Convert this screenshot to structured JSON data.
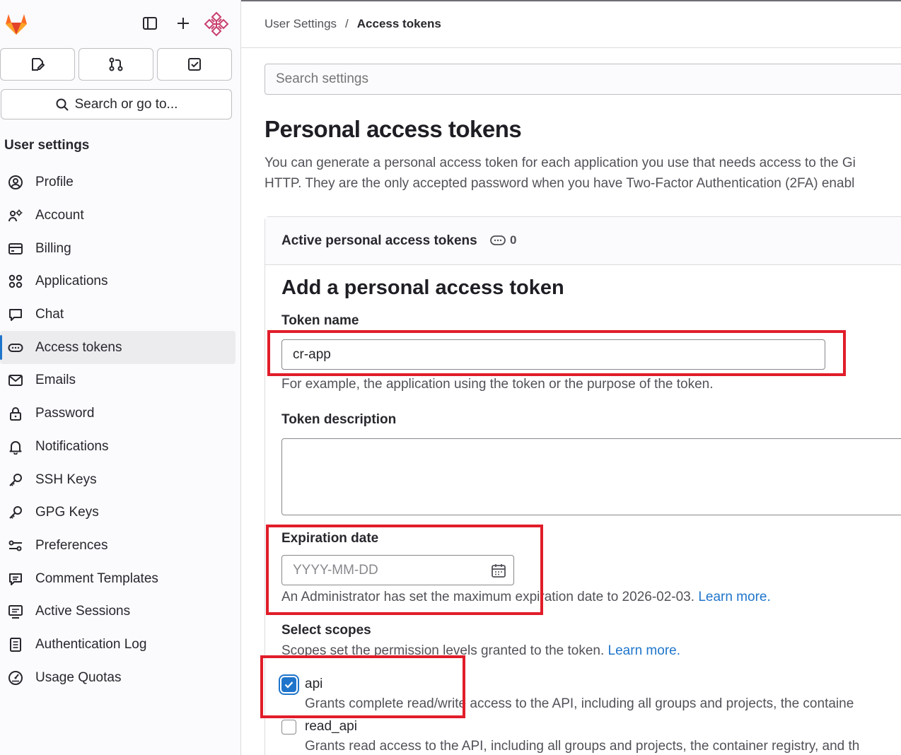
{
  "colors": {
    "accent": "#1f75cb",
    "highlight": "#e11d2a",
    "logo_orange": "#e24329"
  },
  "topbar": {
    "sidebar_toggle_icon": "sidebar-icon",
    "new_icon": "plus-icon",
    "avatar_icon": "avatar-identicon"
  },
  "shortcuts": [
    "issues-icon",
    "merge-request-icon",
    "todo-icon"
  ],
  "search": {
    "label": "Search or go to..."
  },
  "sidebar": {
    "heading": "User settings",
    "items": [
      {
        "label": "Profile",
        "icon": "profile-icon"
      },
      {
        "label": "Account",
        "icon": "account-icon"
      },
      {
        "label": "Billing",
        "icon": "billing-icon"
      },
      {
        "label": "Applications",
        "icon": "applications-icon"
      },
      {
        "label": "Chat",
        "icon": "chat-icon"
      },
      {
        "label": "Access tokens",
        "icon": "token-icon",
        "active": true
      },
      {
        "label": "Emails",
        "icon": "mail-icon"
      },
      {
        "label": "Password",
        "icon": "lock-icon"
      },
      {
        "label": "Notifications",
        "icon": "bell-icon"
      },
      {
        "label": "SSH Keys",
        "icon": "key-icon"
      },
      {
        "label": "GPG Keys",
        "icon": "key-icon"
      },
      {
        "label": "Preferences",
        "icon": "preferences-icon"
      },
      {
        "label": "Comment Templates",
        "icon": "comment-icon"
      },
      {
        "label": "Active Sessions",
        "icon": "monitor-icon"
      },
      {
        "label": "Authentication Log",
        "icon": "log-icon"
      },
      {
        "label": "Usage Quotas",
        "icon": "quota-icon"
      }
    ]
  },
  "breadcrumb": {
    "parent": "User Settings",
    "separator": "/",
    "current": "Access tokens"
  },
  "settings_search": {
    "placeholder": "Search settings"
  },
  "page": {
    "title": "Personal access tokens",
    "desc_line1": "You can generate a personal access token for each application you use that needs access to the Gi",
    "desc_line2": "HTTP. They are the only accepted password when you have Two-Factor Authentication (2FA) enabl"
  },
  "active_tokens": {
    "title": "Active personal access tokens",
    "count": "0",
    "icon": "token-icon"
  },
  "form": {
    "title": "Add a personal access token",
    "token_name": {
      "label": "Token name",
      "value": "cr-app",
      "help": "For example, the application using the token or the purpose of the token."
    },
    "token_description": {
      "label": "Token description",
      "value": ""
    },
    "expiration": {
      "label": "Expiration date",
      "placeholder": "YYYY-MM-DD",
      "help": "An Administrator has set the maximum expiration date to 2026-02-03.",
      "link": "Learn more.",
      "icon": "calendar-icon"
    },
    "scopes": {
      "label": "Select scopes",
      "help": "Scopes set the permission levels granted to the token.",
      "link": "Learn more.",
      "items": [
        {
          "name": "api",
          "checked": true,
          "desc": "Grants complete read/write access to the API, including all groups and projects, the containe"
        },
        {
          "name": "read_api",
          "checked": false,
          "desc": "Grants read access to the API, including all groups and projects, the container registry, and th"
        }
      ]
    }
  }
}
